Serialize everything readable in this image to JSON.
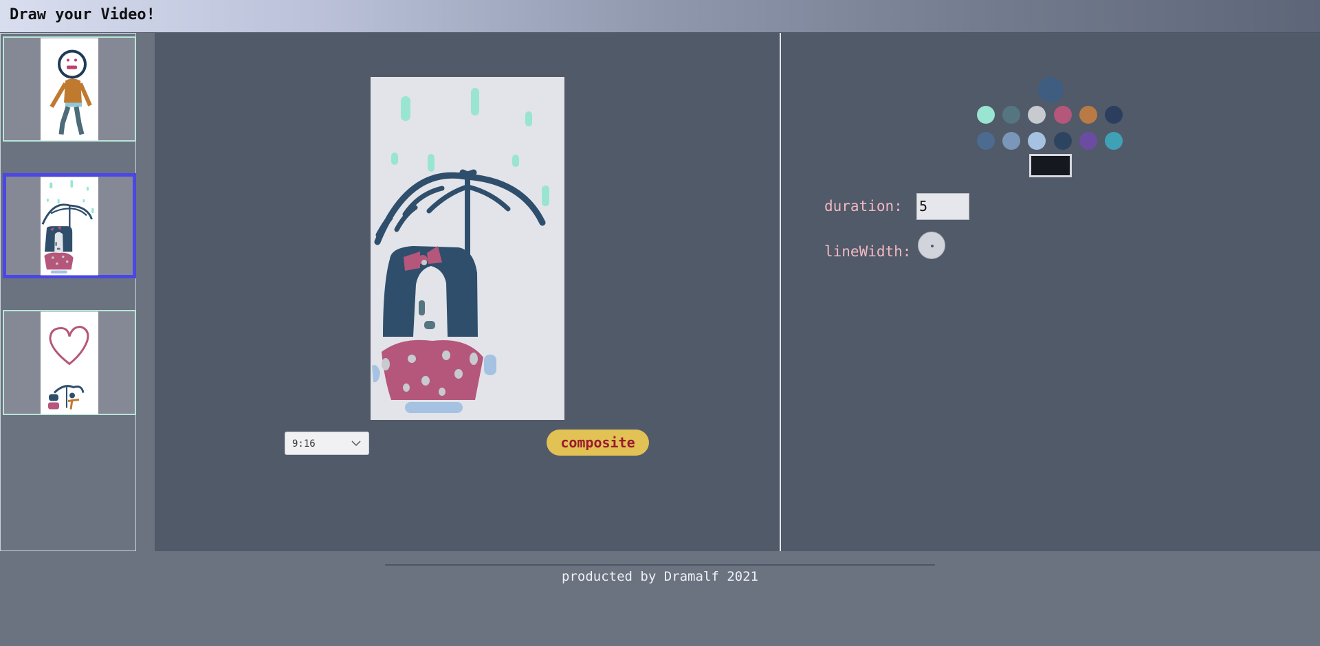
{
  "header": {
    "title": "Draw your Video!"
  },
  "frames": [
    {
      "name": "frame-1"
    },
    {
      "name": "frame-2",
      "selected": true
    },
    {
      "name": "frame-3"
    }
  ],
  "editor": {
    "ratio": {
      "value": "9:16"
    },
    "composite_label": "composite"
  },
  "tools": {
    "selected_color": "#3f5d80",
    "palette": [
      "#99e5d2",
      "#557580",
      "#c7cacf",
      "#b5577a",
      "#b97a45",
      "#2c3e5d",
      "#4c6b90",
      "#7a96b9",
      "#a5c2e2",
      "#2c4460",
      "#6c4ca3",
      "#3fa1b6"
    ],
    "preview_color": "#15181e",
    "duration_label": "duration:",
    "duration_value": "5",
    "linewidth_label": "lineWidth:"
  },
  "footer": {
    "text": "producted by Dramalf 2021"
  }
}
